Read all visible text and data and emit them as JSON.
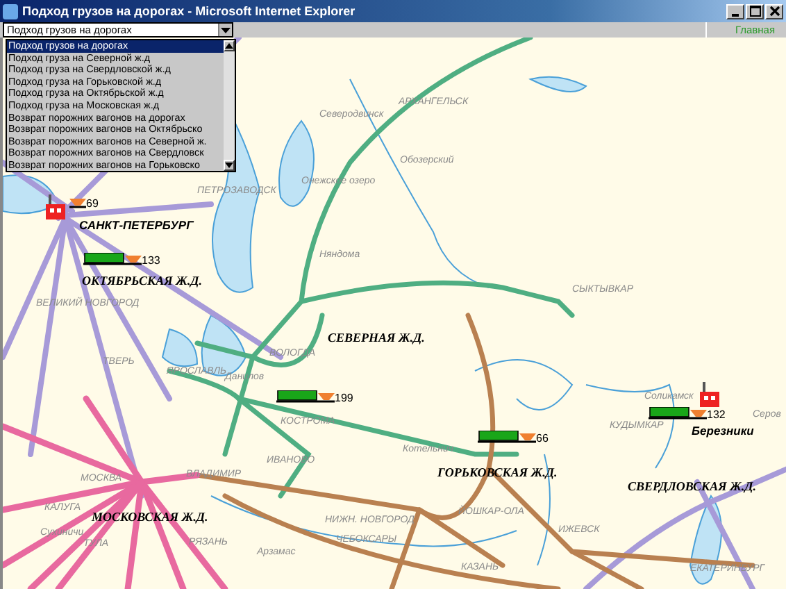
{
  "window": {
    "title": "Подход грузов на дорогах - Microsoft Internet Explorer"
  },
  "toolbar": {
    "report_select": {
      "value": "Подход грузов на дорогах",
      "expanded": true
    },
    "home_link": "Главная"
  },
  "report_options": [
    {
      "label": "Подход грузов на дорогах",
      "selected": true
    },
    {
      "label": "Подход груза на Северной ж.д",
      "selected": false
    },
    {
      "label": "Подход груза на Свердловской ж.д",
      "selected": false
    },
    {
      "label": "Подход груза на Горьковской ж.д",
      "selected": false
    },
    {
      "label": "Подход груза на Октябрьской ж.д",
      "selected": false
    },
    {
      "label": "Подход груза на Московская ж.д",
      "selected": false
    },
    {
      "label": "Возврат порожних вагонов на дорогах",
      "selected": false
    },
    {
      "label": "Возврат порожних вагонов на Октябрьско",
      "selected": false
    },
    {
      "label": "Возврат порожних вагонов на Северной ж.",
      "selected": false
    },
    {
      "label": "Возврат порожних вагонов на Свердловск",
      "selected": false
    },
    {
      "label": "Возврат порожних вагонов на Горьковско",
      "selected": false
    }
  ],
  "map": {
    "railways": [
      "СЕВЕРНАЯ Ж.Д.",
      "ОКТЯБРЬСКАЯ Ж.Д.",
      "ГОРЬКОВСКАЯ Ж.Д.",
      "СВЕРДЛОВСКАЯ Ж.Д.",
      "МОСКОВСКАЯ Ж.Д."
    ],
    "stations": [
      {
        "name": "САНКТ-ПЕТЕРБУРГ"
      },
      {
        "name": "Березники"
      }
    ],
    "trains": [
      {
        "kind": "wagons",
        "count": "69"
      },
      {
        "kind": "train",
        "count": "133"
      },
      {
        "kind": "train",
        "count": "199"
      },
      {
        "kind": "train",
        "count": "66"
      },
      {
        "kind": "train",
        "count": "132"
      }
    ],
    "cities": [
      "АРХАНГЕЛЬСК",
      "Северодвинск",
      "Обозерский",
      "ПЕТРОЗАВОДСК",
      "Онежское озеро",
      "Няндома",
      "СЫКТЫВКАР",
      "ВЕЛИКИЙ НОВГОРОД",
      "ТВЕРЬ",
      "ЯРОСЛАВЛЬ",
      "Данилов",
      "ВОЛОГДА",
      "КОСТРОМА",
      "ИВАНОВО",
      "ВЛАДИМИР",
      "МОСКВА",
      "КАЛУГА",
      "Сухиничи",
      "ТУЛА",
      "РЯЗАНЬ",
      "Арзамас",
      "НИЖН. НОВГОРОД",
      "ЧЕБОКСАРЫ",
      "ЙОШКАР-ОЛА",
      "ИЖЕВСК",
      "КАЗАНЬ",
      "Котельнич",
      "Соликамск",
      "КУДЫМКАР",
      "Серов",
      "ЕКАТЕРИНБУРГ"
    ]
  }
}
